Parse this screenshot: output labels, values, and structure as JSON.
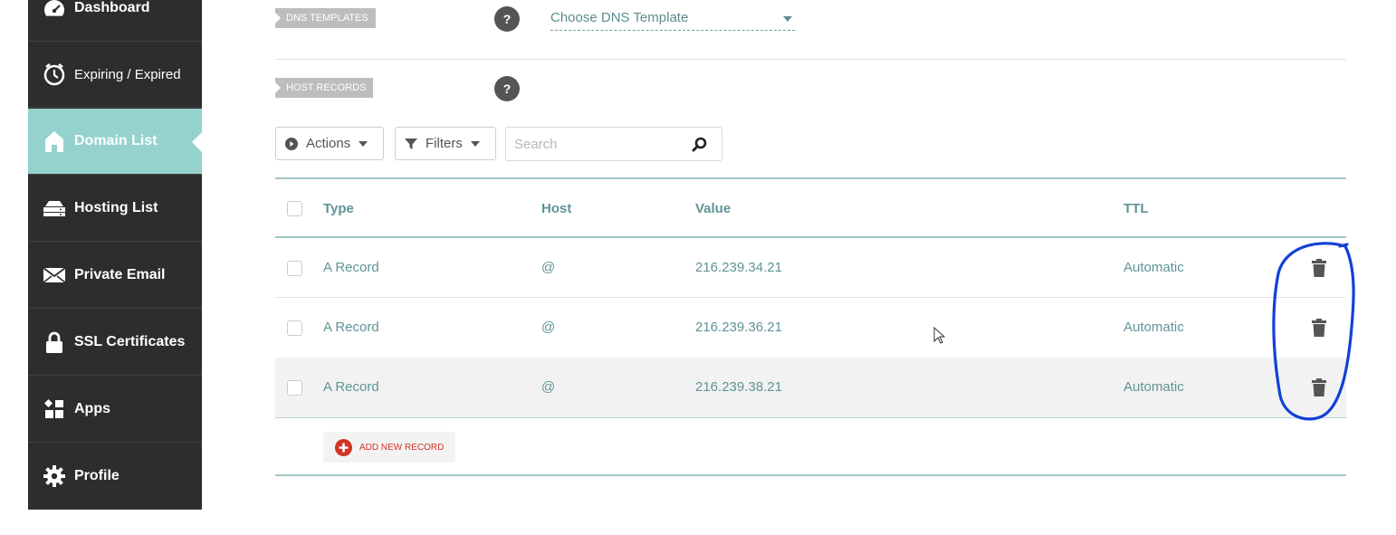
{
  "sidebar": {
    "items": [
      {
        "label": "Dashboard",
        "icon": "dashboard-icon"
      },
      {
        "label": "Expiring / Expired",
        "icon": "clock-icon"
      },
      {
        "label": "Domain List",
        "icon": "home-icon",
        "active": true
      },
      {
        "label": "Hosting List",
        "icon": "server-icon"
      },
      {
        "label": "Private Email",
        "icon": "envelope-icon"
      },
      {
        "label": "SSL Certificates",
        "icon": "lock-icon"
      },
      {
        "label": "Apps",
        "icon": "apps-icon"
      },
      {
        "label": "Profile",
        "icon": "gear-icon"
      }
    ]
  },
  "dns_templates": {
    "tag": "DNS TEMPLATES",
    "help": "?",
    "select_value": "Choose DNS Template"
  },
  "host_records": {
    "tag": "HOST RECORDS",
    "help": "?"
  },
  "toolbar": {
    "actions_label": "Actions",
    "filters_label": "Filters",
    "search_placeholder": "Search"
  },
  "table": {
    "columns": {
      "type": "Type",
      "host": "Host",
      "value": "Value",
      "ttl": "TTL"
    },
    "rows": [
      {
        "type": "A Record",
        "host": "@",
        "value": "216.239.34.21",
        "ttl": "Automatic"
      },
      {
        "type": "A Record",
        "host": "@",
        "value": "216.239.36.21",
        "ttl": "Automatic"
      },
      {
        "type": "A Record",
        "host": "@",
        "value": "216.239.38.21",
        "ttl": "Automatic"
      }
    ]
  },
  "add_record_label": "ADD NEW RECORD",
  "colors": {
    "sidebar_bg": "#2d2d2d",
    "active_item": "#95d1cd",
    "accent_teal": "#5f9496",
    "add_red": "#d43325",
    "annotation_blue": "#1340d6"
  }
}
